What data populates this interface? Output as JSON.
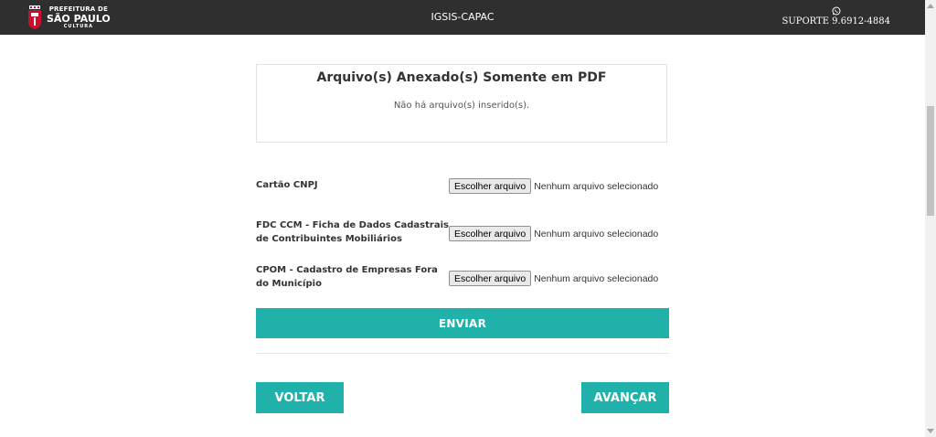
{
  "header": {
    "logo": {
      "line1": "PREFEITURA DE",
      "line2": "SÃO PAULO",
      "line3": "CULTURA"
    },
    "app_title": "IGSIS-CAPAC",
    "support": {
      "icon": "whatsapp-icon",
      "text": "SUPORTE 9.6912-4884"
    }
  },
  "attachments": {
    "title": "Arquivo(s) Anexado(s) Somente em PDF",
    "empty_message": "Não há arquivo(s) inserido(s)."
  },
  "documents": [
    {
      "label": "Cartão CNPJ",
      "button": "Escolher arquivo",
      "status": "Nenhum arquivo selecionado"
    },
    {
      "label": "FDC CCM - Ficha de Dados Cadastrais de Contribuintes Mobiliários",
      "button": "Escolher arquivo",
      "status": "Nenhum arquivo selecionado"
    },
    {
      "label": "CPOM - Cadastro de Empresas Fora do Município",
      "button": "Escolher arquivo",
      "status": "Nenhum arquivo selecionado"
    }
  ],
  "actions": {
    "submit": "ENVIAR",
    "back": "VOLTAR",
    "next": "AVANÇAR"
  },
  "colors": {
    "accent": "#20b2aa",
    "header_bg": "#2f2f2f"
  }
}
